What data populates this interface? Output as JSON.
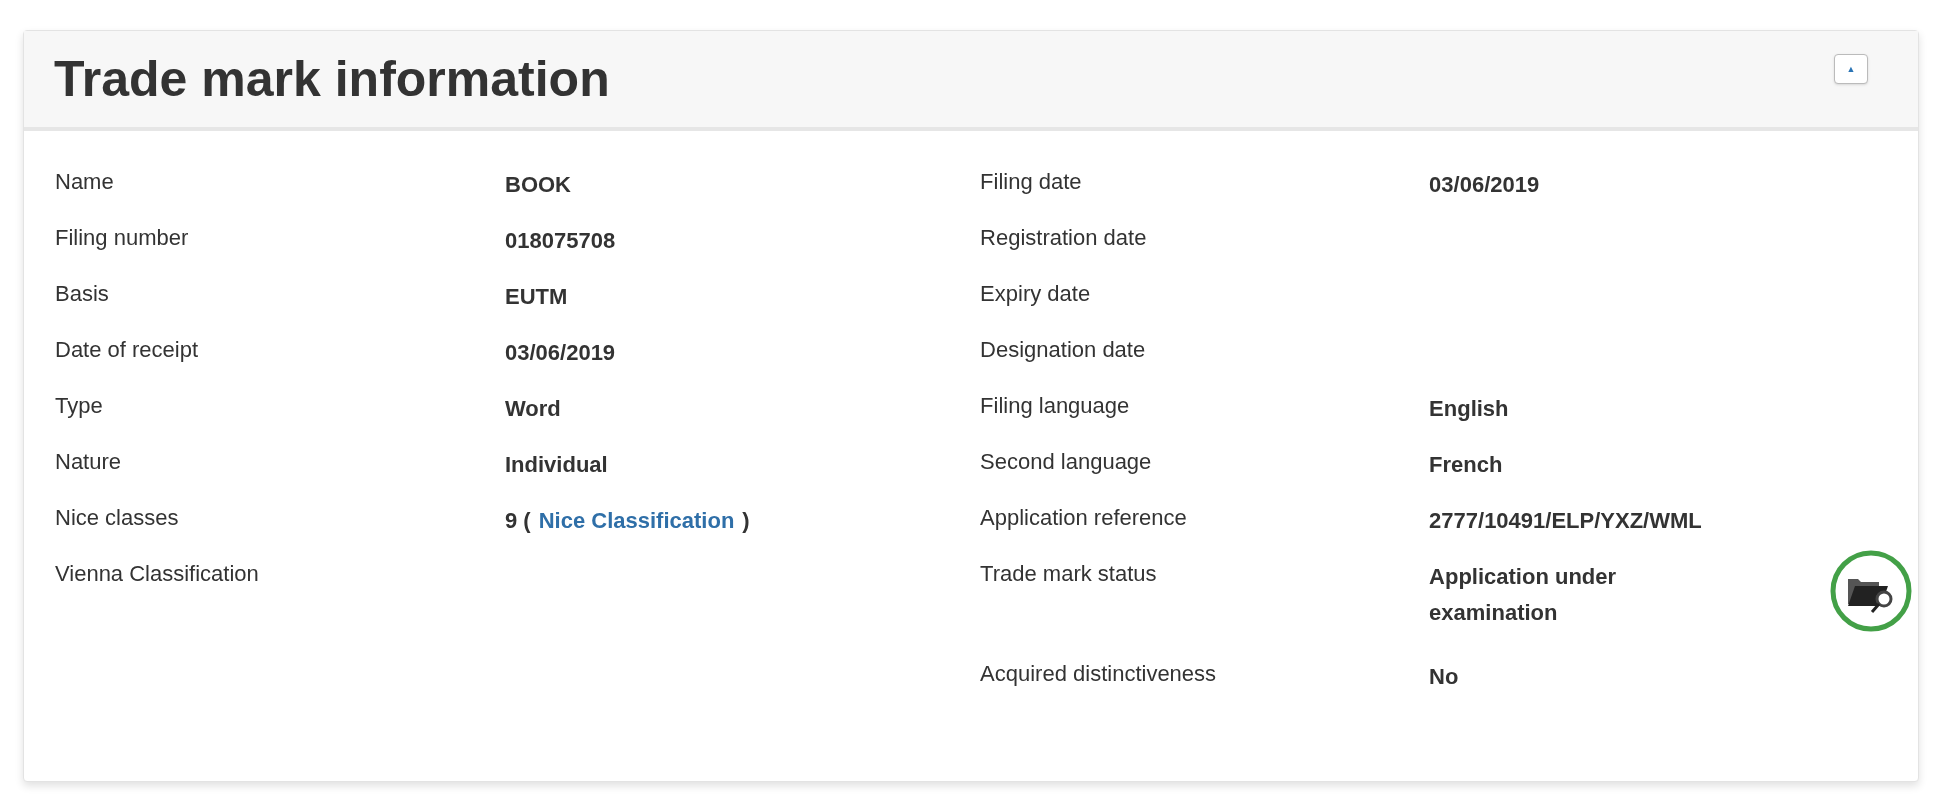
{
  "panel": {
    "title": "Trade mark information",
    "collapse_button": "▲"
  },
  "left_fields": [
    {
      "label": "Name",
      "value": "BOOK"
    },
    {
      "label": "Filing number",
      "value": "018075708"
    },
    {
      "label": "Basis",
      "value": "EUTM"
    },
    {
      "label": "Date of receipt",
      "value": "03/06/2019"
    },
    {
      "label": "Type",
      "value": "Word"
    },
    {
      "label": "Nature",
      "value": "Individual"
    },
    {
      "label": "Nice classes",
      "value": "9 (",
      "link": "Nice Classification",
      "value_suffix": ")"
    },
    {
      "label": "Vienna Classification"
    }
  ],
  "right_fields": [
    {
      "label": "Filing date",
      "value": "03/06/2019"
    },
    {
      "label": "Registration date"
    },
    {
      "label": "Expiry date"
    },
    {
      "label": "Designation date"
    },
    {
      "label": "Filing language",
      "value": "English"
    },
    {
      "label": "Second language",
      "value": "French"
    },
    {
      "label": "Application reference",
      "value": "2777/10491/ELP/YXZ/WML"
    },
    {
      "label": "Trade mark status",
      "value": "Application under examination",
      "kind": "status"
    },
    {
      "label": "Acquired distinctiveness",
      "value": "No"
    }
  ]
}
